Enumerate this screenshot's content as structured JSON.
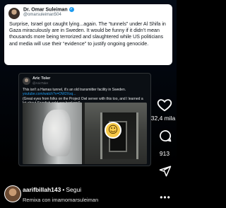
{
  "tweet": {
    "author_name": "Dr. Omar Suleiman",
    "author_handle": "@omarsuleiman504",
    "text": "Surprise, Israel got caught lying...again. The “tunnels” under Al Shifa in Gaza miraculously are in Sweden. It would be funny if it didn’t mean thousands more being terrorized and slaughtered while US politicians and media will use their “evidence” to justify ongoing genocide."
  },
  "quoted_tweet": {
    "author_name": "Aric Toler",
    "author_handle": "@AricToler",
    "line1": "This isn't a Hamas tunnel, it's an old transmitter facility in Sweden.",
    "link": "youtube.com/watch?v=OW2Xsq...",
    "line2": "(Great eyes from folks on the Project Owl server with this too, and I learned a lot about Swedish cold war bunkers!)"
  },
  "rail": {
    "like_count": "32,4 mila",
    "comment_count": "913",
    "more": "•••"
  },
  "post": {
    "username": "aarifbillah143",
    "separator": "•",
    "follow_label": "Segui",
    "remix_text": "Remixa con imamomarsuleiman"
  },
  "icons": {
    "heart": "heart-icon",
    "comment": "comment-icon",
    "share": "share-icon",
    "emoji": "smirk-emoji"
  }
}
